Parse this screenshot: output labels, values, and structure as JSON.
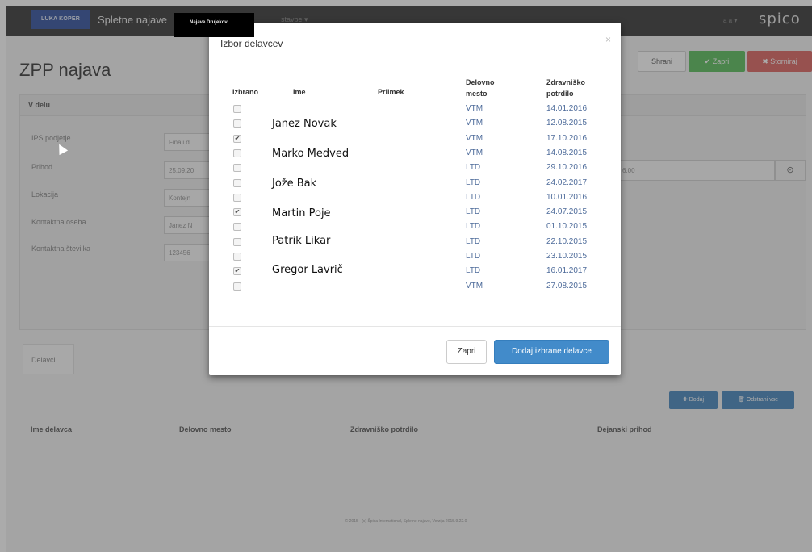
{
  "navbar": {
    "logo_text": "LUKA KOPER",
    "app_title": "Spletne najave",
    "menu_item": "stavbe ▾",
    "user_menu": "a a ▾",
    "brand": "spico",
    "highlight_tab": "Najave Drujekov"
  },
  "page": {
    "title": "ZPP najava",
    "buttons": {
      "save": "Shrani",
      "close": "✔ Zapri",
      "cancel": "✖ Storniraj"
    },
    "panel_title": "V delu",
    "form": {
      "labels": [
        "IPS podjetje",
        "Prihod",
        "Lokacija",
        "Kontaktna oseba",
        "Kontaktna številka"
      ],
      "values": [
        "Finali d",
        "25.09.20",
        "Kontejn",
        "Janez N",
        "123456"
      ],
      "right_value": "6.00",
      "clock_icon": "clock-icon"
    },
    "tab_label": "Delavci",
    "workers_buttons": {
      "add": "✚ Dodaj",
      "remove": "🗑 Odstrani vse"
    },
    "workers_columns": [
      "Ime delavca",
      "Delovno mesto",
      "Zdravniško potrdilo",
      "Dejanski prihod"
    ],
    "footer": "© 2015 - (c) Špica International, Spletne najave, Verzija 2015.9.22.0"
  },
  "modal": {
    "title": "Izbor delavcev",
    "close_glyph": "×",
    "columns": {
      "selected": "Izbrano",
      "first_name": "Ime",
      "last_name": "Priimek",
      "workplace": "Delovno mesto",
      "medical": "Zdravniško potrdilo"
    },
    "rows": [
      {
        "checked": false,
        "workplace": "VTM",
        "medical": "14.01.2016"
      },
      {
        "checked": false,
        "workplace": "VTM",
        "medical": "12.08.2015"
      },
      {
        "checked": true,
        "workplace": "VTM",
        "medical": "17.10.2016"
      },
      {
        "checked": false,
        "workplace": "VTM",
        "medical": "14.08.2015"
      },
      {
        "checked": false,
        "workplace": "LTD",
        "medical": "29.10.2016"
      },
      {
        "checked": false,
        "workplace": "LTD",
        "medical": "24.02.2017"
      },
      {
        "checked": false,
        "workplace": "LTD",
        "medical": "10.01.2016"
      },
      {
        "checked": true,
        "workplace": "LTD",
        "medical": "24.07.2015"
      },
      {
        "checked": false,
        "workplace": "LTD",
        "medical": "01.10.2015"
      },
      {
        "checked": false,
        "workplace": "LTD",
        "medical": "22.10.2015"
      },
      {
        "checked": false,
        "workplace": "LTD",
        "medical": "23.10.2015"
      },
      {
        "checked": true,
        "workplace": "LTD",
        "medical": "16.01.2017"
      },
      {
        "checked": false,
        "workplace": "VTM",
        "medical": "27.08.2015"
      }
    ],
    "handwritten_names": [
      "Janez Novak",
      "Marko Medved",
      "Jože Bak",
      "Martin Poje",
      "Patrik Likar",
      "Gregor Lavrič"
    ],
    "buttons": {
      "close": "Zapri",
      "add_selected": "Dodaj izbrane delavce"
    }
  }
}
